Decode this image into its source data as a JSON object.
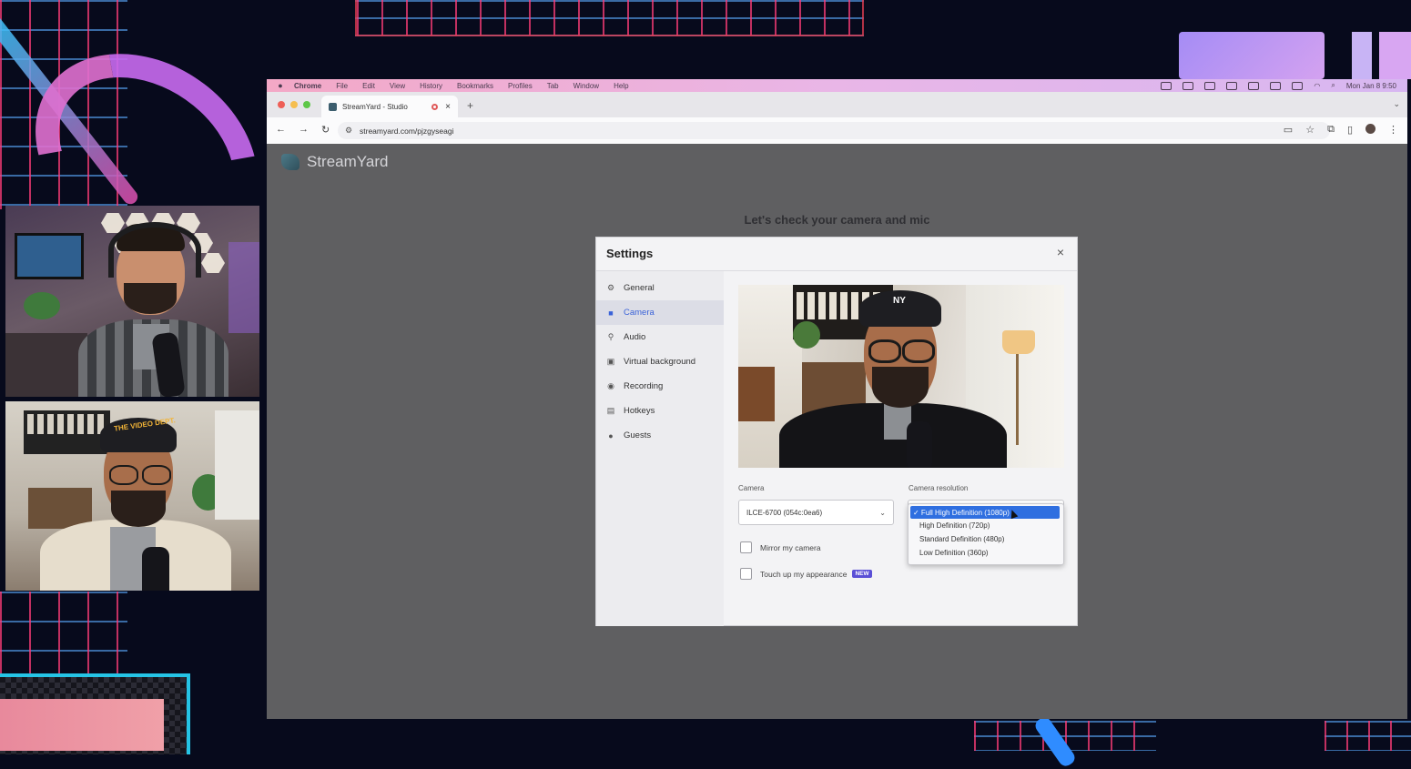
{
  "menubar": {
    "apple": "",
    "items": [
      "Chrome",
      "File",
      "Edit",
      "View",
      "History",
      "Bookmarks",
      "Profiles",
      "Tab",
      "Window",
      "Help"
    ],
    "clock": "Mon Jan 8 9:50"
  },
  "browser": {
    "tab_title": "StreamYard - Studio",
    "tab_close": "×",
    "new_tab": "+",
    "url": "streamyard.com/pjzgyseagi"
  },
  "page": {
    "logo_text": "StreamYard",
    "heading": "Let's check your camera and mic"
  },
  "settings": {
    "title": "Settings",
    "close": "×",
    "nav": [
      {
        "label": "General",
        "icon": "gear-icon"
      },
      {
        "label": "Camera",
        "icon": "camera-icon",
        "active": true
      },
      {
        "label": "Audio",
        "icon": "mic-icon"
      },
      {
        "label": "Virtual background",
        "icon": "portrait-icon"
      },
      {
        "label": "Recording",
        "icon": "record-icon"
      },
      {
        "label": "Hotkeys",
        "icon": "keyboard-icon"
      },
      {
        "label": "Guests",
        "icon": "person-icon"
      }
    ],
    "camera_label": "Camera",
    "camera_value": "ILCE-6700 (054c:0ea6)",
    "resolution_label": "Camera resolution",
    "resolution_options": [
      "✓ Full High Definition (1080p)",
      "High Definition (720p)",
      "Standard Definition (480p)",
      "Low Definition (360p)"
    ],
    "mirror_label": "Mirror my camera",
    "touchup_label": "Touch up my appearance",
    "new_badge": "NEW"
  },
  "overlay": {
    "cap_text": "THE VIDEO DEPT."
  },
  "colors": {
    "accent": "#3a62d8",
    "selected_option": "#2f6fe0",
    "badge": "#5a4fd6"
  }
}
